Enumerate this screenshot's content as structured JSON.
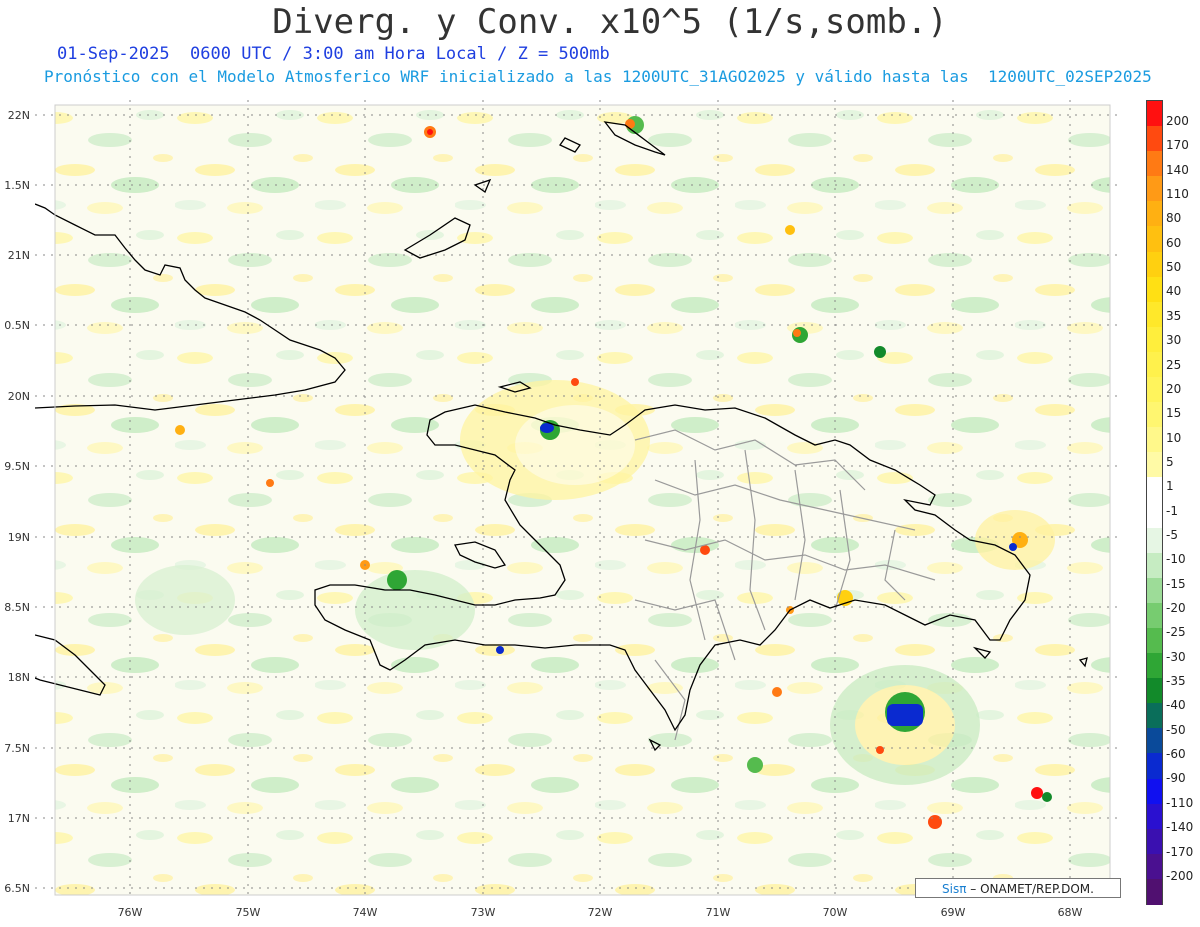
{
  "title": "Diverg. y Conv. x10^5 (1/s,somb.)",
  "subtitle_time": "01-Sep-2025  0600 UTC / 3:00 am Hora Local / Z = 500mb",
  "subtitle_model": "Pronóstico con el Modelo Atmosferico WRF inicializado a las 1200UTC_31AGO2025 y válido hasta las  1200UTC_02SEP2025",
  "lat_labels": [
    "22N",
    "1.5N",
    "21N",
    "0.5N",
    "20N",
    "9.5N",
    "19N",
    "8.5N",
    "18N",
    "7.5N",
    "17N",
    "6.5N"
  ],
  "lon_labels": [
    "76W",
    "75W",
    "74W",
    "73W",
    "72W",
    "71W",
    "70W",
    "69W",
    "68W"
  ],
  "colorbar": {
    "labels": [
      "200",
      "170",
      "140",
      "110",
      "80",
      "60",
      "50",
      "40",
      "35",
      "30",
      "25",
      "20",
      "15",
      "10",
      "5",
      "1",
      "-1",
      "-5",
      "-10",
      "-15",
      "-20",
      "-25",
      "-30",
      "-35",
      "-40",
      "-50",
      "-60",
      "-90",
      "-110",
      "-140",
      "-170",
      "-200"
    ],
    "colors": [
      "#ff1010",
      "#ff4a10",
      "#ff7a14",
      "#ff9a16",
      "#ffb012",
      "#ffc010",
      "#ffd010",
      "#ffe014",
      "#ffe82a",
      "#ffee3c",
      "#fff14c",
      "#fff45c",
      "#fff670",
      "#fff88a",
      "#fffaa6",
      "#ffffff",
      "#ffffff",
      "#e6f6e4",
      "#c6ecc2",
      "#9ddc98",
      "#77cc70",
      "#55bb4e",
      "#2fa635",
      "#128a2a",
      "#0a6e5a",
      "#0a4a9a",
      "#0a2ad0",
      "#1010f0",
      "#2a10d0",
      "#3a10b0",
      "#4a1090",
      "#501070"
    ]
  },
  "credit": {
    "logo": "Sisπ",
    "text": " – ONAMET/REP.DOM."
  },
  "colors": {
    "border": "#000000",
    "provinces": "#9a9a9a",
    "grid": "#888888",
    "title": "#333333",
    "subtitle_time": "#1f3fe0",
    "subtitle_model": "#1a9be0"
  }
}
